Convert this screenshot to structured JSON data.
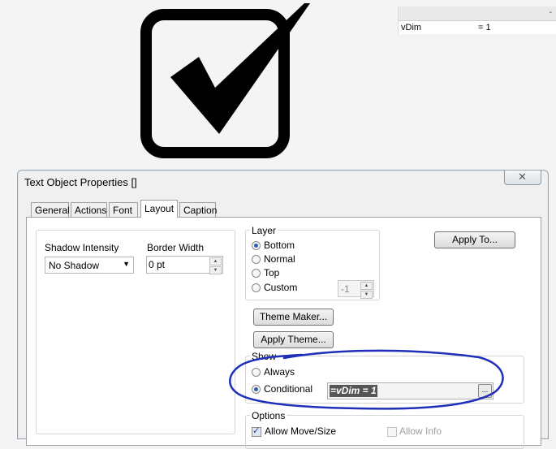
{
  "variables": {
    "header_mark": "-",
    "rows": [
      {
        "name": "vDim",
        "value": "= 1"
      }
    ]
  },
  "dialog": {
    "title": "Text Object Properties []",
    "close_icon": "close-icon",
    "tabs": [
      {
        "label": "General",
        "active": false
      },
      {
        "label": "Actions",
        "active": false
      },
      {
        "label": "Font",
        "active": false
      },
      {
        "label": "Layout",
        "active": true
      },
      {
        "label": "Caption",
        "active": false
      }
    ],
    "shadow_intensity": {
      "label": "Shadow Intensity",
      "value": "No Shadow"
    },
    "border_width": {
      "label": "Border Width",
      "value": "0 pt"
    },
    "layer": {
      "title": "Layer",
      "options": [
        "Bottom",
        "Normal",
        "Top",
        "Custom"
      ],
      "selected": "Bottom",
      "custom_value": "-1"
    },
    "buttons": {
      "apply_to": "Apply To...",
      "theme_maker": "Theme Maker...",
      "apply_theme": "Apply Theme..."
    },
    "show": {
      "title": "Show",
      "always": "Always",
      "conditional": "Conditional",
      "selected": "Conditional",
      "condition_value": "=vDim = 1",
      "ellipsis": "..."
    },
    "options": {
      "title": "Options",
      "allow_move": "Allow Move/Size",
      "allow_info": "Allow Info"
    }
  },
  "colors": {
    "annotation": "#1f2fb8",
    "radio_dot": "#2a60b0"
  }
}
